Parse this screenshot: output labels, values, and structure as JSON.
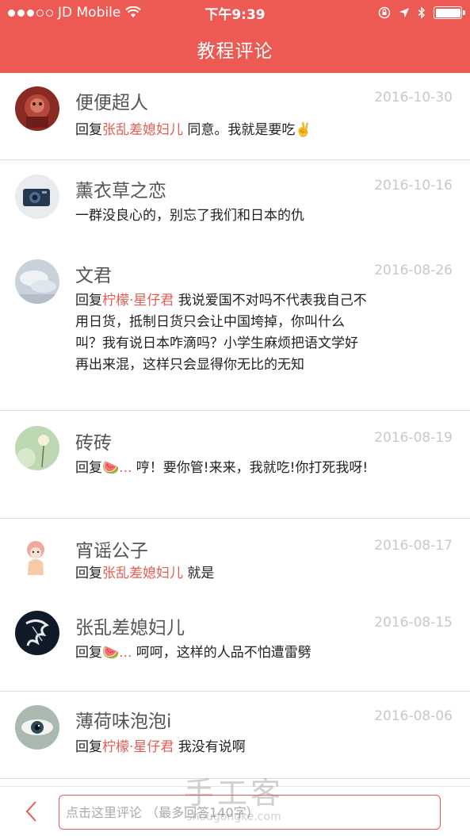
{
  "status_bar": {
    "carrier": "JD Mobile",
    "time": "下午9:39"
  },
  "nav": {
    "title": "教程评论"
  },
  "comments": [
    {
      "username": "便便超人",
      "date": "2016-10-30",
      "reply_prefix": "回复",
      "reply_target": "张乱差媳妇儿",
      "text": " 同意。我就是要吃✌️"
    },
    {
      "username": "薰衣草之恋",
      "date": "2016-10-16",
      "reply_prefix": "",
      "reply_target": "",
      "text": "一群没良心的，别忘了我们和日本的仇"
    },
    {
      "username": "文君",
      "date": "2016-08-26",
      "reply_prefix": "回复",
      "reply_target": "柠檬·星仔君",
      "text": " 我说爱国不对吗不代表我自己不用日货，抵制日货只会让中国垮掉，你叫什么叫？我有说日本咋滴吗？小学生麻烦把语文学好再出来混，这样只会显得你无比的无知"
    },
    {
      "username": "砖砖",
      "date": "2016-08-19",
      "reply_prefix": "回复",
      "reply_target": "🍉...",
      "text": " 哼！要你管!来来，我就吃!你打死我呀!"
    },
    {
      "username": "宵谣公子",
      "date": "2016-08-17",
      "reply_prefix": "回复",
      "reply_target": "张乱差媳妇儿",
      "text": " 就是"
    },
    {
      "username": "张乱差媳妇儿",
      "date": "2016-08-15",
      "reply_prefix": "回复",
      "reply_target": "🍉...",
      "text": " 呵呵，这样的人品不怕遭雷劈"
    },
    {
      "username": "薄荷味泡泡i",
      "date": "2016-08-06",
      "reply_prefix": "回复",
      "reply_target": "柠檬·星仔君",
      "text": " 我没有说啊"
    }
  ],
  "bottom_bar": {
    "input_placeholder": "点击这里评论 （最多回答140字）"
  },
  "watermark": {
    "title": "手工客",
    "url": "shougongke.com"
  },
  "colors": {
    "brand": "#ec5a53",
    "reply_target": "#e65b52",
    "date": "#c8c8c8"
  }
}
